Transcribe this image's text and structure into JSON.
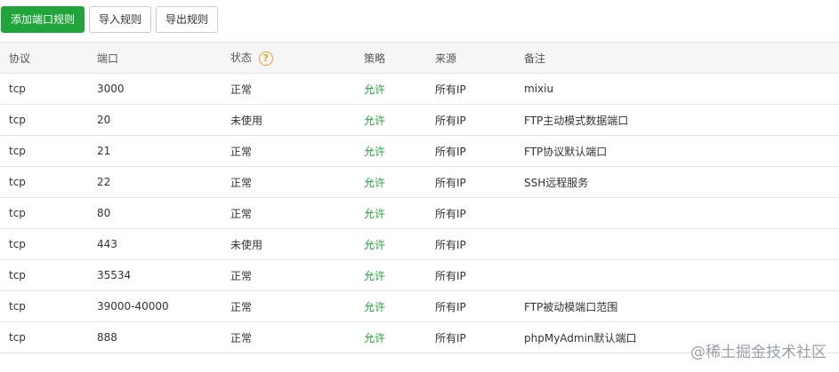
{
  "toolbar": {
    "add_label": "添加端口规则",
    "import_label": "导入规则",
    "export_label": "导出规则"
  },
  "table": {
    "headers": {
      "protocol": "协议",
      "port": "端口",
      "status": "状态",
      "status_help": "?",
      "policy": "策略",
      "source": "来源",
      "remark": "备注"
    },
    "rows": [
      {
        "protocol": "tcp",
        "port": "3000",
        "status": "正常",
        "policy": "允许",
        "source": "所有IP",
        "remark": "mixiu"
      },
      {
        "protocol": "tcp",
        "port": "20",
        "status": "未使用",
        "policy": "允许",
        "source": "所有IP",
        "remark": "FTP主动模式数据端口"
      },
      {
        "protocol": "tcp",
        "port": "21",
        "status": "正常",
        "policy": "允许",
        "source": "所有IP",
        "remark": "FTP协议默认端口"
      },
      {
        "protocol": "tcp",
        "port": "22",
        "status": "正常",
        "policy": "允许",
        "source": "所有IP",
        "remark": "SSH远程服务"
      },
      {
        "protocol": "tcp",
        "port": "80",
        "status": "正常",
        "policy": "允许",
        "source": "所有IP",
        "remark": ""
      },
      {
        "protocol": "tcp",
        "port": "443",
        "status": "未使用",
        "policy": "允许",
        "source": "所有IP",
        "remark": ""
      },
      {
        "protocol": "tcp",
        "port": "35534",
        "status": "正常",
        "policy": "允许",
        "source": "所有IP",
        "remark": ""
      },
      {
        "protocol": "tcp",
        "port": "39000-40000",
        "status": "正常",
        "policy": "允许",
        "source": "所有IP",
        "remark": "FTP被动模端口范围"
      },
      {
        "protocol": "tcp",
        "port": "888",
        "status": "正常",
        "policy": "允许",
        "source": "所有IP",
        "remark": "phpMyAdmin默认端口"
      }
    ]
  },
  "watermark": {
    "text": "@稀土掘金技术社区"
  },
  "colors": {
    "primary": "#20a53a",
    "allow": "#20a53a",
    "help_icon": "#f0a02a"
  },
  "icons": {
    "status_help": "question-circle-icon"
  }
}
